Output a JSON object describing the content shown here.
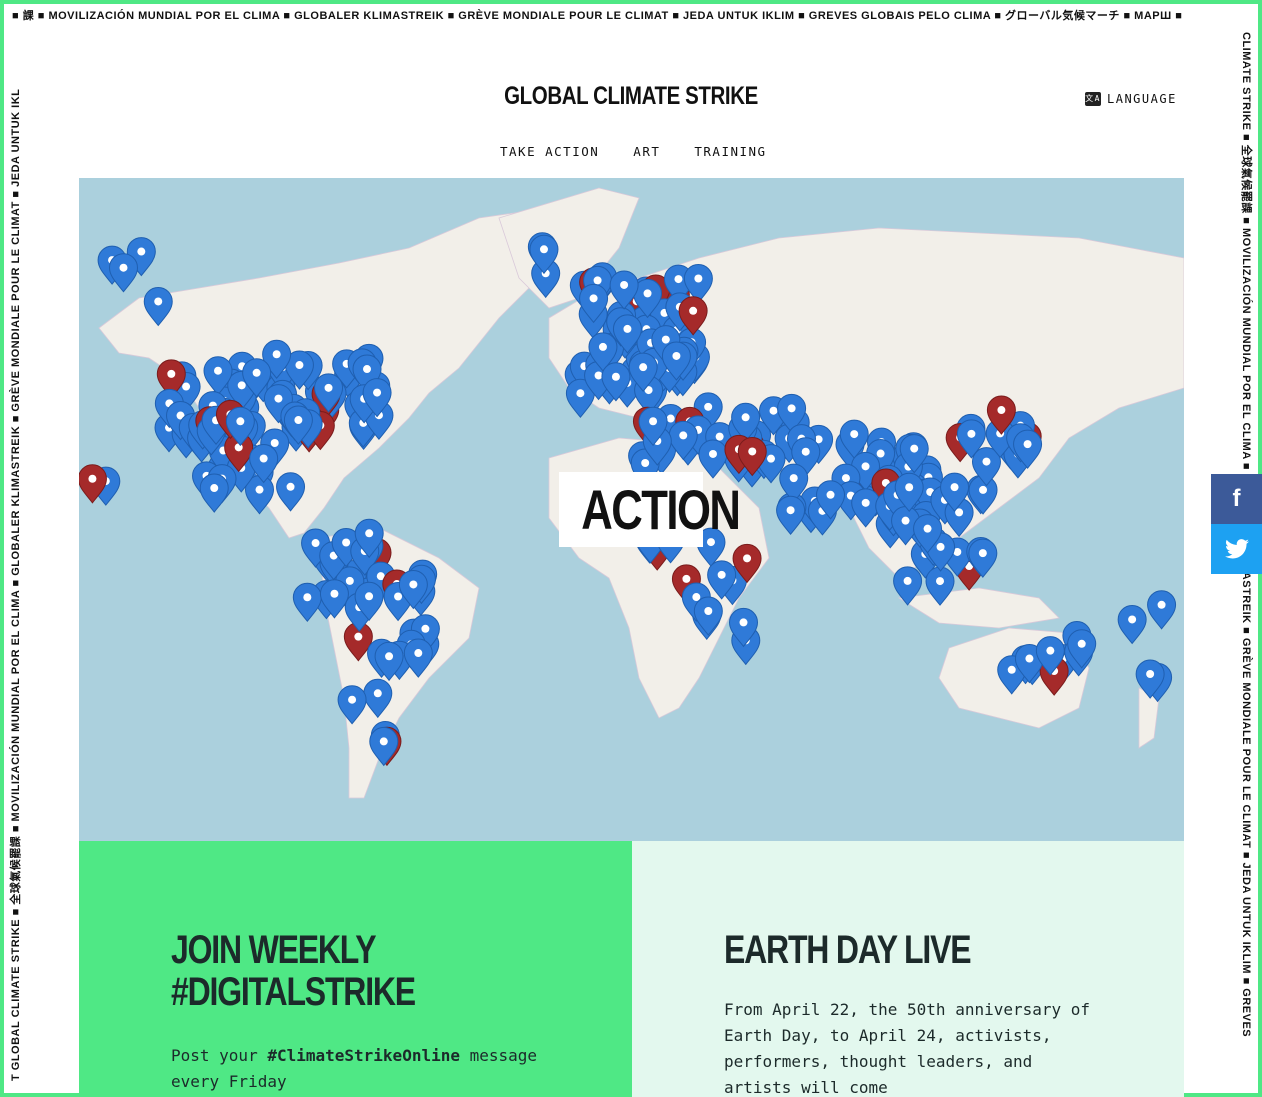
{
  "ticker": {
    "top": "■ 課 ■ MOVILIZACIÓN MUNDIAL POR EL CLIMA ■ GLOBALER KLIMASTREIK ■ GRÈVE MONDIALE POUR LE CLIMAT ■ JEDA UNTUK IKLIM ■ GREVES GLOBAIS PELO CLIMA ■ グローバル気候マーチ ■ МАРШ ■",
    "left": "T GLOBAL CLIMATE STRIKE ■ 全球氣候罷課 ■ MOVILIZACIÓN MUNDIAL POR EL CLIMA ■ GLOBALER KLIMASTREIK ■ GRÈVE MONDIALE POUR LE CLIMAT ■ JEDA UNTUK IKL",
    "right": "CLIMATE STRIKE ■ 全球氣候罷課 ■ MOVILIZACIÓN MUNDIAL POR EL CLIMA ■ GLOBALER KLIMASTREIK ■ GRÈVE MONDIALE POUR LE CLIMAT ■ JEDA UNTUK IKLIM ■ GREVES"
  },
  "header": {
    "title": "GLOBAL CLIMATE STRIKE",
    "language_label": "LANGUAGE",
    "language_icon": "translate-icon"
  },
  "nav": {
    "items": [
      {
        "label": "TAKE ACTION"
      },
      {
        "label": "ART"
      },
      {
        "label": "TRAINING"
      }
    ]
  },
  "map": {
    "label": "ACTION",
    "colors": {
      "water": "#abd0dd",
      "land": "#f2efe9",
      "pin_blue": "#2f7ad8",
      "pin_red": "#a52a2a"
    }
  },
  "social": {
    "facebook": "f",
    "twitter": "twitter-icon"
  },
  "cards": {
    "left": {
      "title_line1": "JOIN WEEKLY",
      "title_line2": "#DIGITALSTRIKE",
      "body_prefix": "Post your ",
      "body_highlight": "#ClimateStrikeOnline",
      "body_suffix": " message every Friday"
    },
    "right": {
      "title": "EARTH DAY LIVE",
      "body": "From April 22, the 50th anniversary of Earth Day, to April 24, activists, performers, thought leaders, and artists will come"
    }
  },
  "colors": {
    "accent": "#4fe885",
    "facebook": "#3c5a99",
    "twitter": "#1da1f2"
  }
}
